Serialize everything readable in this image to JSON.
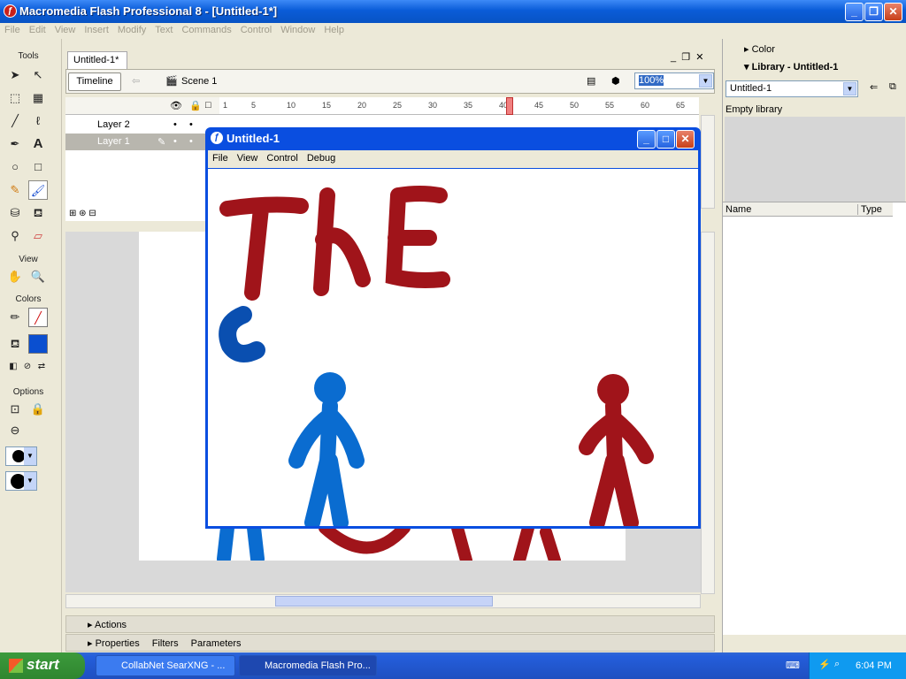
{
  "app": {
    "title": "Macromedia Flash Professional 8 - [Untitled-1*]"
  },
  "menu": [
    "File",
    "Edit",
    "View",
    "Insert",
    "Modify",
    "Text",
    "Commands",
    "Control",
    "Window",
    "Help"
  ],
  "toolbox": {
    "tools_label": "Tools",
    "view_label": "View",
    "colors_label": "Colors",
    "options_label": "Options",
    "stroke_color": "#a01010",
    "fill_color": "#0a4fd0"
  },
  "document": {
    "tab": "Untitled-1*",
    "timeline_button": "Timeline",
    "scene": "Scene 1",
    "zoom": "100%"
  },
  "timeline": {
    "ruler": [
      "1",
      "5",
      "10",
      "15",
      "20",
      "25",
      "30",
      "35",
      "40",
      "45",
      "50",
      "55",
      "60",
      "65"
    ],
    "playhead_frame": 40,
    "layers": [
      {
        "name": "Layer 2",
        "active": false
      },
      {
        "name": "Layer 1",
        "active": true
      }
    ]
  },
  "panels": {
    "actions": "Actions",
    "properties": "Properties",
    "filters": "Filters",
    "parameters": "Parameters"
  },
  "right_panel": {
    "color": "Color",
    "library": "Library - Untitled-1",
    "library_select": "Untitled-1",
    "empty": "Empty library",
    "col_name": "Name",
    "col_type": "Type"
  },
  "player": {
    "title": "Untitled-1",
    "menu": [
      "File",
      "View",
      "Control",
      "Debug"
    ]
  },
  "drawing": {
    "text": "THE",
    "red": "#a0141a",
    "blue": "#0a6cd0"
  },
  "taskbar": {
    "start": "start",
    "tasks": [
      "CollabNet SearXNG - ...",
      "Macromedia Flash Pro..."
    ],
    "time": "6:04 PM"
  }
}
